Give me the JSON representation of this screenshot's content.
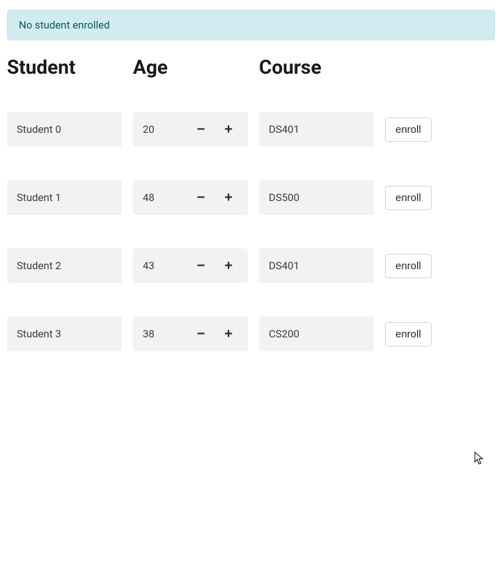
{
  "alert": {
    "message": "No student enrolled"
  },
  "headers": {
    "student": "Student",
    "age": "Age",
    "course": "Course"
  },
  "buttons": {
    "enroll": "enroll",
    "minus": "−",
    "plus": "+"
  },
  "students": [
    {
      "name": "Student 0",
      "age": "20",
      "course": "DS401"
    },
    {
      "name": "Student 1",
      "age": "48",
      "course": "DS500"
    },
    {
      "name": "Student 2",
      "age": "43",
      "course": "DS401"
    },
    {
      "name": "Student 3",
      "age": "38",
      "course": "CS200"
    }
  ]
}
